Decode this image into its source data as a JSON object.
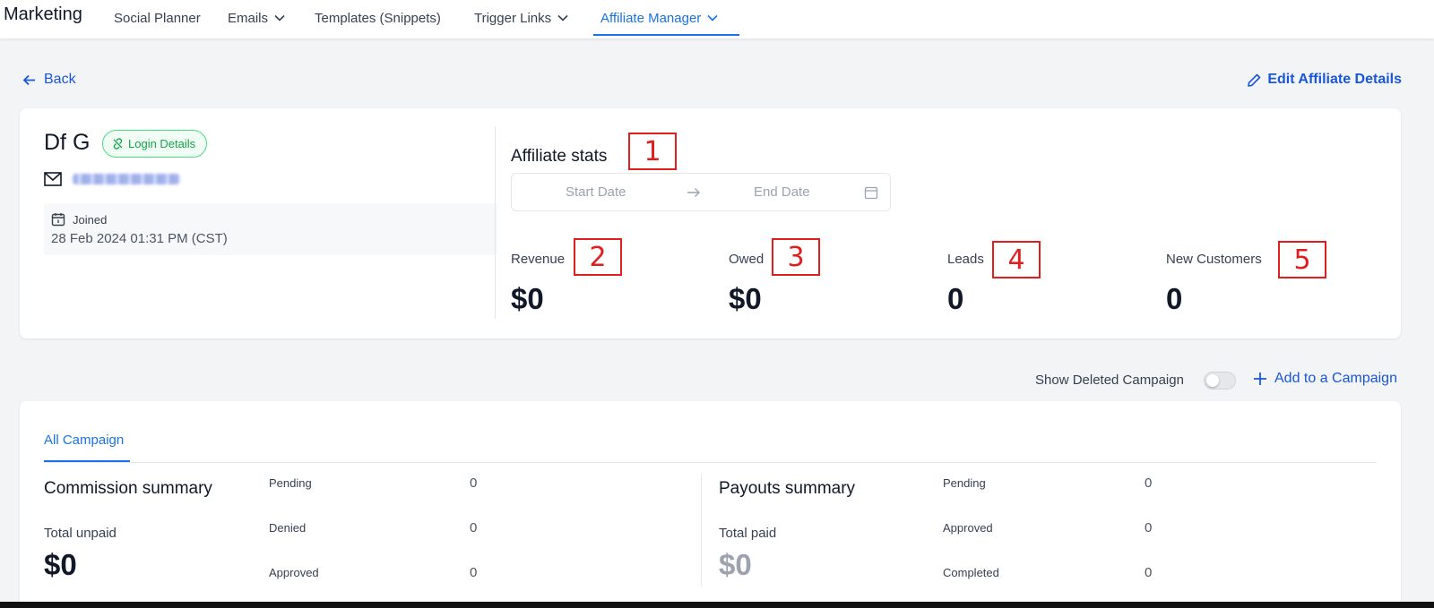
{
  "nav": {
    "brand": "Marketing",
    "items": [
      {
        "label": "Social Planner",
        "dropdown": false
      },
      {
        "label": "Emails",
        "dropdown": true
      },
      {
        "label": "Templates (Snippets)",
        "dropdown": false
      },
      {
        "label": "Trigger Links",
        "dropdown": true
      },
      {
        "label": "Affiliate Manager",
        "dropdown": true,
        "active": true
      }
    ]
  },
  "header": {
    "back_label": "Back",
    "edit_label": "Edit Affiliate Details"
  },
  "profile": {
    "name": "Df G",
    "login_badge": "Login Details",
    "joined_label": "Joined",
    "joined_date": "28 Feb 2024 01:31 PM (CST)"
  },
  "stats": {
    "title": "Affiliate stats",
    "start_placeholder": "Start Date",
    "end_placeholder": "End Date",
    "items": [
      {
        "label": "Revenue",
        "value": "$0"
      },
      {
        "label": "Owed",
        "value": "$0"
      },
      {
        "label": "Leads",
        "value": "0"
      },
      {
        "label": "New Customers",
        "value": "0"
      }
    ]
  },
  "annotations": [
    "1",
    "2",
    "3",
    "4",
    "5"
  ],
  "campaign_controls": {
    "show_deleted_label": "Show Deleted Campaign",
    "show_deleted_on": false,
    "add_label": "Add to a Campaign"
  },
  "campaign": {
    "tab": "All Campaign",
    "commission": {
      "title": "Commission summary",
      "total_label": "Total unpaid",
      "total_value": "$0",
      "rows": [
        {
          "label": "Pending",
          "value": "0"
        },
        {
          "label": "Denied",
          "value": "0"
        },
        {
          "label": "Approved",
          "value": "0"
        }
      ]
    },
    "payouts": {
      "title": "Payouts summary",
      "total_label": "Total paid",
      "total_value": "$0",
      "rows": [
        {
          "label": "Pending",
          "value": "0"
        },
        {
          "label": "Approved",
          "value": "0"
        },
        {
          "label": "Completed",
          "value": "0"
        }
      ]
    }
  },
  "colors": {
    "accent": "#1a73e8",
    "link": "#1a56db",
    "badge_green": "#16a34a",
    "annotation_red": "#e11d1d"
  }
}
